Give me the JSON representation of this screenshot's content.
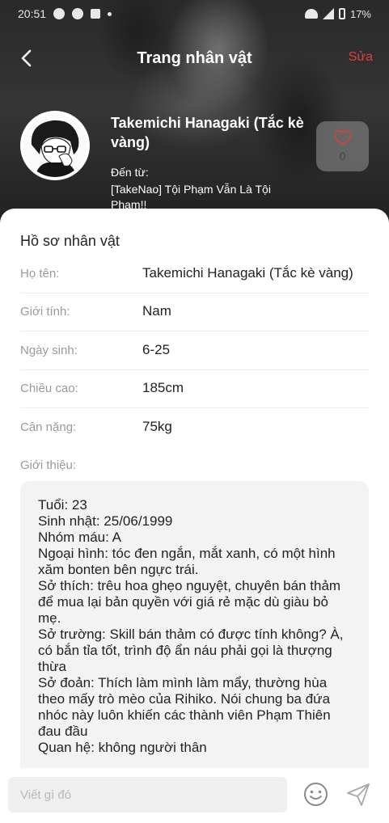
{
  "status_bar": {
    "time": "20:51",
    "battery": "17%",
    "icons": [
      "messenger-icon",
      "person-icon",
      "photo-icon",
      "dot-icon",
      "wifi-icon",
      "signal-icon",
      "battery-icon"
    ]
  },
  "header": {
    "title": "Trang nhân vật",
    "edit_label": "Sửa",
    "back_icon": "chevron-left-icon"
  },
  "character": {
    "name": "Takemichi Hanagaki (Tắc kè vàng)",
    "from_label": "Đến từ:",
    "from_value": "[TakeNao] Tội Phạm Vẫn Là Tội Phạm!!",
    "likes": "0"
  },
  "profile": {
    "section_title": "Hồ sơ nhân vật",
    "fields": [
      {
        "label": "Họ tên:",
        "value": "Takemichi Hanagaki (Tắc kè vàng)"
      },
      {
        "label": "Giới tính:",
        "value": "Nam"
      },
      {
        "label": "Ngày sinh:",
        "value": "6-25"
      },
      {
        "label": "Chiều cao:",
        "value": "185cm"
      },
      {
        "label": "Cân nặng:",
        "value": "75kg"
      }
    ],
    "intro_label": "Giới thiệu:",
    "intro_text": "Tuổi: 23\nSinh nhật: 25/06/1999\nNhóm máu: A\nNgoại hình: tóc đen ngắn, mắt xanh, có một hình xăm bonten bên ngực trái.\nSở thích: trêu hoa ghẹo nguyệt, chuyên bán thảm để mua lại bản quyền với giá rẻ mặc dù giàu bỏ mẹ.\nSở trường: Skill bán thảm có được tính không? À, có bắn tỉa tốt, trình độ ẩn náu phải gọi là thượng thừa\nSở đoản: Thích làm mình làm mẩy, thường hùa theo mấy trò mèo của Rihiko. Nói chung ba đứa nhóc này luôn khiến các thành viên Phạm Thiên đau đầu\nQuan hệ: không người thân"
  },
  "composer": {
    "placeholder": "Viết gì đó",
    "emoji_icon": "smile-icon",
    "send_icon": "send-icon"
  },
  "colors": {
    "accent": "#e0403c",
    "sheet": "#ffffff",
    "intro_bg": "#f3f3f3"
  }
}
